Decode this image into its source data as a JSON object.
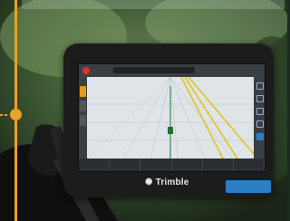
{
  "photo": {
    "device_brand": "Trimble",
    "badge": {
      "logo": "",
      "sub": ""
    }
  },
  "screen": {
    "guide_text": "",
    "bottom_cells": [
      {
        "label": "",
        "value": ""
      },
      {
        "label": "",
        "value": ""
      },
      {
        "label": "",
        "value": ""
      },
      {
        "label": "",
        "value": ""
      },
      {
        "label": "",
        "value": ""
      },
      {
        "label": "",
        "value": ""
      }
    ]
  },
  "colors": {
    "accent_timeline": "#e8a22a",
    "brand_blue": "#2a7ec4",
    "record_red": "#d8322d"
  }
}
